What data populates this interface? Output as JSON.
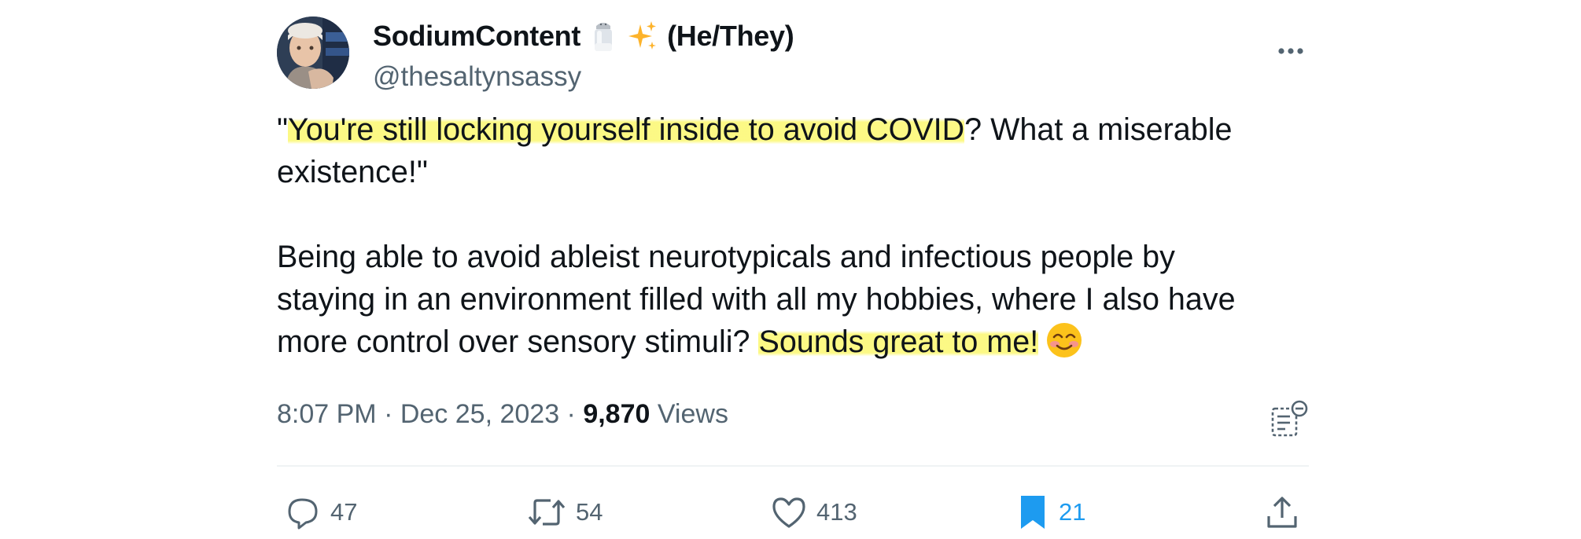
{
  "tweet": {
    "author": {
      "display_name": "SodiumContent",
      "emojis": [
        "salt-shaker-emoji",
        "sparkles-emoji"
      ],
      "pronouns": "(He/They)",
      "handle": "@thesaltynsassy"
    },
    "text": {
      "line1_prefix": "\"",
      "line1_highlight": "You're still locking yourself inside to avoid COVID",
      "line1_suffix": "? What a miserable",
      "line2": "existence!\"",
      "line3": "Being able to avoid ableist neurotypicals and infectious people by",
      "line4": "staying in an environment filled with all my hobbies, where I also have",
      "line5_prefix": "more control over sensory stimuli? ",
      "line5_highlight": "Sounds great to me!",
      "emoji": "smiling-face-emoji",
      "highlight_color": "#fcf878"
    },
    "meta": {
      "time": "8:07 PM",
      "separator": " · ",
      "date": "Dec 25, 2023",
      "views_count": "9,870",
      "views_label": " Views"
    },
    "actions": {
      "replies": "47",
      "reposts": "54",
      "likes": "413",
      "bookmarks": "21"
    },
    "colors": {
      "text": "#0f1419",
      "secondary": "#536471",
      "accent": "#1d9bf0",
      "divider": "#eff3f4"
    }
  }
}
